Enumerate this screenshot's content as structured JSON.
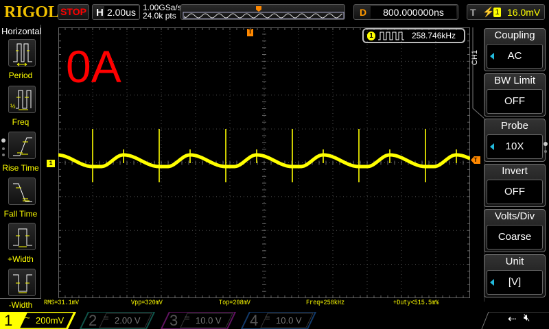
{
  "header": {
    "logo": "RIGOL",
    "run_state": "STOP",
    "h_label": "H",
    "timebase": "2.00us",
    "sample_rate": "1.00GSa/s",
    "memory_depth": "24.0k pts",
    "d_label": "D",
    "delay": "800.000000ns",
    "t_label": "T",
    "trigger_source": "1",
    "trigger_level": "16.0mV"
  },
  "left_menu": {
    "title": "Horizontal",
    "items": [
      {
        "label": "Period",
        "icon": "period-icon"
      },
      {
        "label": "Freq",
        "icon": "freq-icon"
      },
      {
        "label": "Rise Time",
        "icon": "rise-time-icon"
      },
      {
        "label": "Fall Time",
        "icon": "fall-time-icon"
      },
      {
        "label": "+Width",
        "icon": "pos-width-icon"
      },
      {
        "label": "-Width",
        "icon": "neg-width-icon"
      }
    ]
  },
  "screen": {
    "annotation": "0A",
    "freq_counter": "258.746kHz",
    "freq_channel": "1",
    "ch_marker": "1",
    "trig_marker": "T",
    "ch_tab": "CH1"
  },
  "right_menu": [
    {
      "title": "Coupling",
      "value": "AC",
      "arrow": true
    },
    {
      "title": "BW Limit",
      "value": "OFF",
      "arrow": false
    },
    {
      "title": "Probe",
      "value": "10X",
      "arrow": true
    },
    {
      "title": "Invert",
      "value": "OFF",
      "arrow": false
    },
    {
      "title": "Volts/Div",
      "value": "Coarse",
      "arrow": false
    },
    {
      "title": "Unit",
      "value": "[V]",
      "arrow": true
    }
  ],
  "measurements": [
    "RMS=31.1mV",
    "Vpp=320mV",
    "Top=208mV",
    "Freq=258kHz",
    "+Duty<515.5m%"
  ],
  "channels": [
    {
      "num": "1",
      "coupling": "~",
      "scale": "200mV",
      "color": "#ffff00"
    },
    {
      "num": "2",
      "coupling": "=",
      "scale": "2.00 V",
      "color": "#1a8a7a"
    },
    {
      "num": "3",
      "coupling": "=",
      "scale": "10.0 V",
      "color": "#a020a0"
    },
    {
      "num": "4",
      "coupling": "=",
      "scale": "10.0 V",
      "color": "#2060b0"
    }
  ],
  "colors": {
    "trace": "#ffff00",
    "accent": "#ff8c00",
    "logo": "#f0c000",
    "stop": "#ff0000"
  }
}
